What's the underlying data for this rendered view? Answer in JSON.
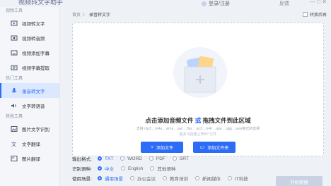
{
  "app": {
    "title": "视频转文字助手",
    "status": "登录/注册",
    "feedback": "反馈",
    "window_controls": "— □ ✕"
  },
  "sidebar": {
    "groups": [
      {
        "title": "视频工具",
        "items": [
          {
            "label": "视频转文字",
            "icon": "video-text-icon"
          },
          {
            "label": "视频转音频",
            "icon": "video-audio-icon"
          },
          {
            "label": "视频添加字幕",
            "icon": "subtitle-add-icon"
          },
          {
            "label": "视频字幕提取",
            "icon": "subtitle-extract-icon"
          }
        ]
      },
      {
        "title": "热门工具",
        "items": [
          {
            "label": "录音转文字",
            "icon": "audio-text-icon",
            "active": true
          },
          {
            "label": "文字转语音",
            "icon": "text-speech-icon"
          }
        ]
      },
      {
        "title": "其他工具",
        "items": [
          {
            "label": "图片文字识别",
            "icon": "image-ocr-icon"
          },
          {
            "label": "文字翻译",
            "icon": "text-translate-icon"
          },
          {
            "label": "图片翻译",
            "icon": "image-translate-icon"
          }
        ]
      }
    ]
  },
  "breadcrumb": {
    "home": "首页",
    "sep": "〉",
    "current": "录音转文字"
  },
  "convert_option": "转换后再",
  "dropzone": {
    "title_prefix": "点击添加音频文件 ",
    "title_or": "或",
    "title_suffix": " 拖拽文件到此区域",
    "formats": "支持.mp3 , .m4a , .wma , .aac , .flac , .ac3 , .m4r , .ape , .ogg , .wav格式的音频",
    "limit": "最多可批量上传8个文件"
  },
  "buttons": {
    "add_file": "添加文件",
    "add_folder": "添加文件夹",
    "start": "开始转换"
  },
  "options": {
    "output_format": {
      "label": "输出格式:",
      "choices": [
        "TXT",
        "WORD",
        "PDF",
        "SRT"
      ],
      "selected": 0
    },
    "language": {
      "label": "识别语种:",
      "choices": [
        "中文",
        "English",
        "其他语种"
      ],
      "selected": 0
    },
    "scene": {
      "label": "使用场景:",
      "choices": [
        "通用场景",
        "办公会议",
        "教育培训",
        "新闻媒体",
        "IT科技"
      ],
      "selected": 0
    }
  },
  "colors": {
    "accent": "#2d6cf6",
    "sidebar_active_bg": "#dbe8ff",
    "disabled": "#c9d2e3"
  }
}
